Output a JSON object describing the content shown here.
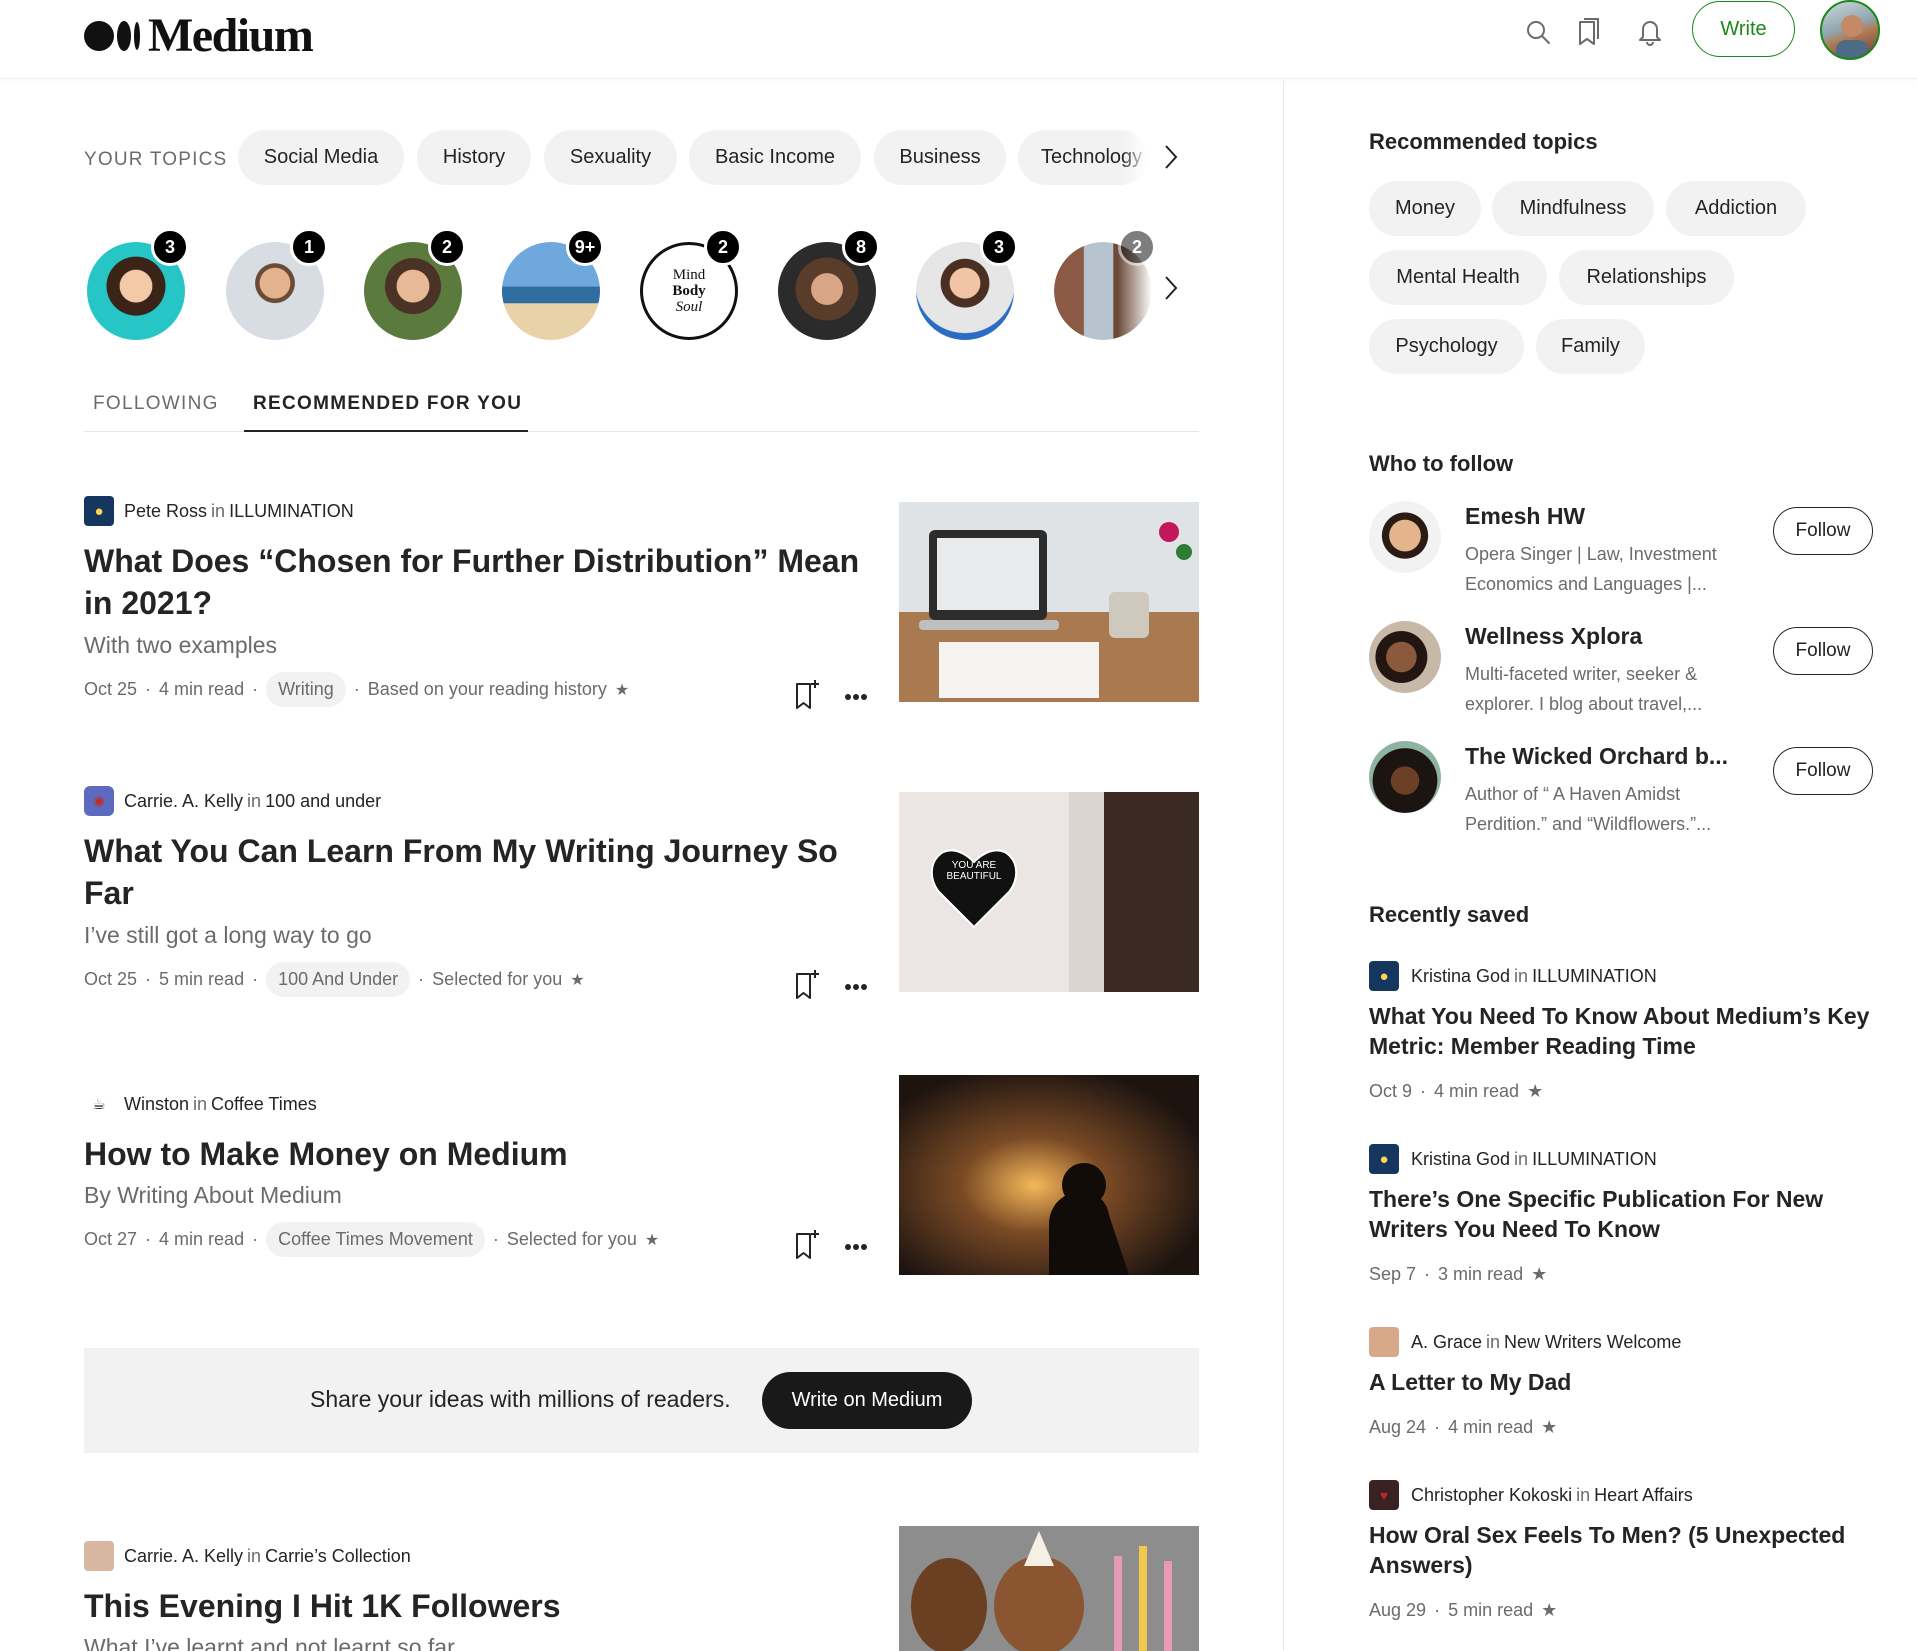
{
  "header": {
    "logo_text": "Medium",
    "write_label": "Write",
    "icons": [
      "search-icon",
      "bookmarks-icon",
      "notifications-icon"
    ]
  },
  "topics": {
    "label": "YOUR TOPICS",
    "items": [
      "Social Media",
      "History",
      "Sexuality",
      "Basic Income",
      "Business",
      "Technology"
    ]
  },
  "followed": {
    "badges": [
      "3",
      "1",
      "2",
      "9+",
      "2",
      "8",
      "3",
      "2"
    ],
    "mind_body_logo": [
      "Mind",
      "Body",
      "Soul"
    ]
  },
  "tabs": {
    "following": "FOLLOWING",
    "recommended": "RECOMMENDED FOR YOU"
  },
  "articles": [
    {
      "author": "Pete Ross",
      "in": "in",
      "publication": "ILLUMINATION",
      "title": "What Does “Chosen for Further Distribution” Mean in 2021?",
      "subtitle": "With two examples",
      "date": "Oct 25",
      "read_time": "4 min read",
      "tag": "Writing",
      "reason": "Based on your reading history"
    },
    {
      "author": "Carrie. A. Kelly",
      "in": "in",
      "publication": "100 and under",
      "title": "What You Can Learn From My Writing Journey So Far",
      "subtitle": "I’ve still got a long way to go",
      "date": "Oct 25",
      "read_time": "5 min read",
      "tag": "100 And Under",
      "reason": "Selected for you",
      "image_text": "YOU ARE BEAUTIFUL"
    },
    {
      "author": "Winston",
      "in": "in",
      "publication": "Coffee Times",
      "title": "How to Make Money on Medium",
      "subtitle": "By Writing About Medium",
      "date": "Oct 27",
      "read_time": "4 min read",
      "tag": "Coffee Times Movement",
      "reason": "Selected for you"
    },
    {
      "author": "Carrie. A. Kelly",
      "in": "in",
      "publication": "Carrie’s Collection",
      "title": "This Evening I Hit 1K Followers",
      "subtitle": "What I’ve learnt and not learnt so far"
    }
  ],
  "share": {
    "text": "Share your ideas with millions of readers.",
    "button": "Write on Medium"
  },
  "sidebar": {
    "recommended_topics_title": "Recommended topics",
    "recommended_topics": [
      "Money",
      "Mindfulness",
      "Addiction",
      "Mental Health",
      "Relationships",
      "Psychology",
      "Family"
    ],
    "who_to_follow_title": "Who to follow",
    "who_to_follow": [
      {
        "name": "Emesh HW",
        "bio": "Opera Singer | Law, Investment Economics and Languages |...",
        "button": "Follow"
      },
      {
        "name": "Wellness Xplora",
        "bio": "Multi-faceted writer, seeker & explorer. I blog about travel,...",
        "button": "Follow"
      },
      {
        "name": "The Wicked Orchard b...",
        "bio": "Author of “ A Haven Amidst Perdition.” and “Wildflowers.”...",
        "button": "Follow"
      }
    ],
    "recently_saved_title": "Recently saved",
    "recently_saved": [
      {
        "author": "Kristina God",
        "in": "in",
        "publication": "ILLUMINATION",
        "title": "What You Need To Know About Medium’s Key Metric: Member Reading Time",
        "date": "Oct 9",
        "read_time": "4 min read"
      },
      {
        "author": "Kristina God",
        "in": "in",
        "publication": "ILLUMINATION",
        "title": "There’s One Specific Publication For New Writers You Need To Know",
        "date": "Sep 7",
        "read_time": "3 min read"
      },
      {
        "author": "A. Grace",
        "in": "in",
        "publication": "New Writers Welcome",
        "title": "A Letter to My Dad",
        "date": "Aug 24",
        "read_time": "4 min read"
      },
      {
        "author": "Christopher Kokoski",
        "in": "in",
        "publication": "Heart Affairs",
        "title": "How Oral Sex Feels To Men? (5 Unexpected Answers)",
        "date": "Aug 29",
        "read_time": "5 min read"
      }
    ]
  },
  "colors": {
    "accent_green": "#1a8917",
    "chip_bg": "#f2f2f2",
    "text_primary": "#242424",
    "text_muted": "#6b6b6b"
  }
}
